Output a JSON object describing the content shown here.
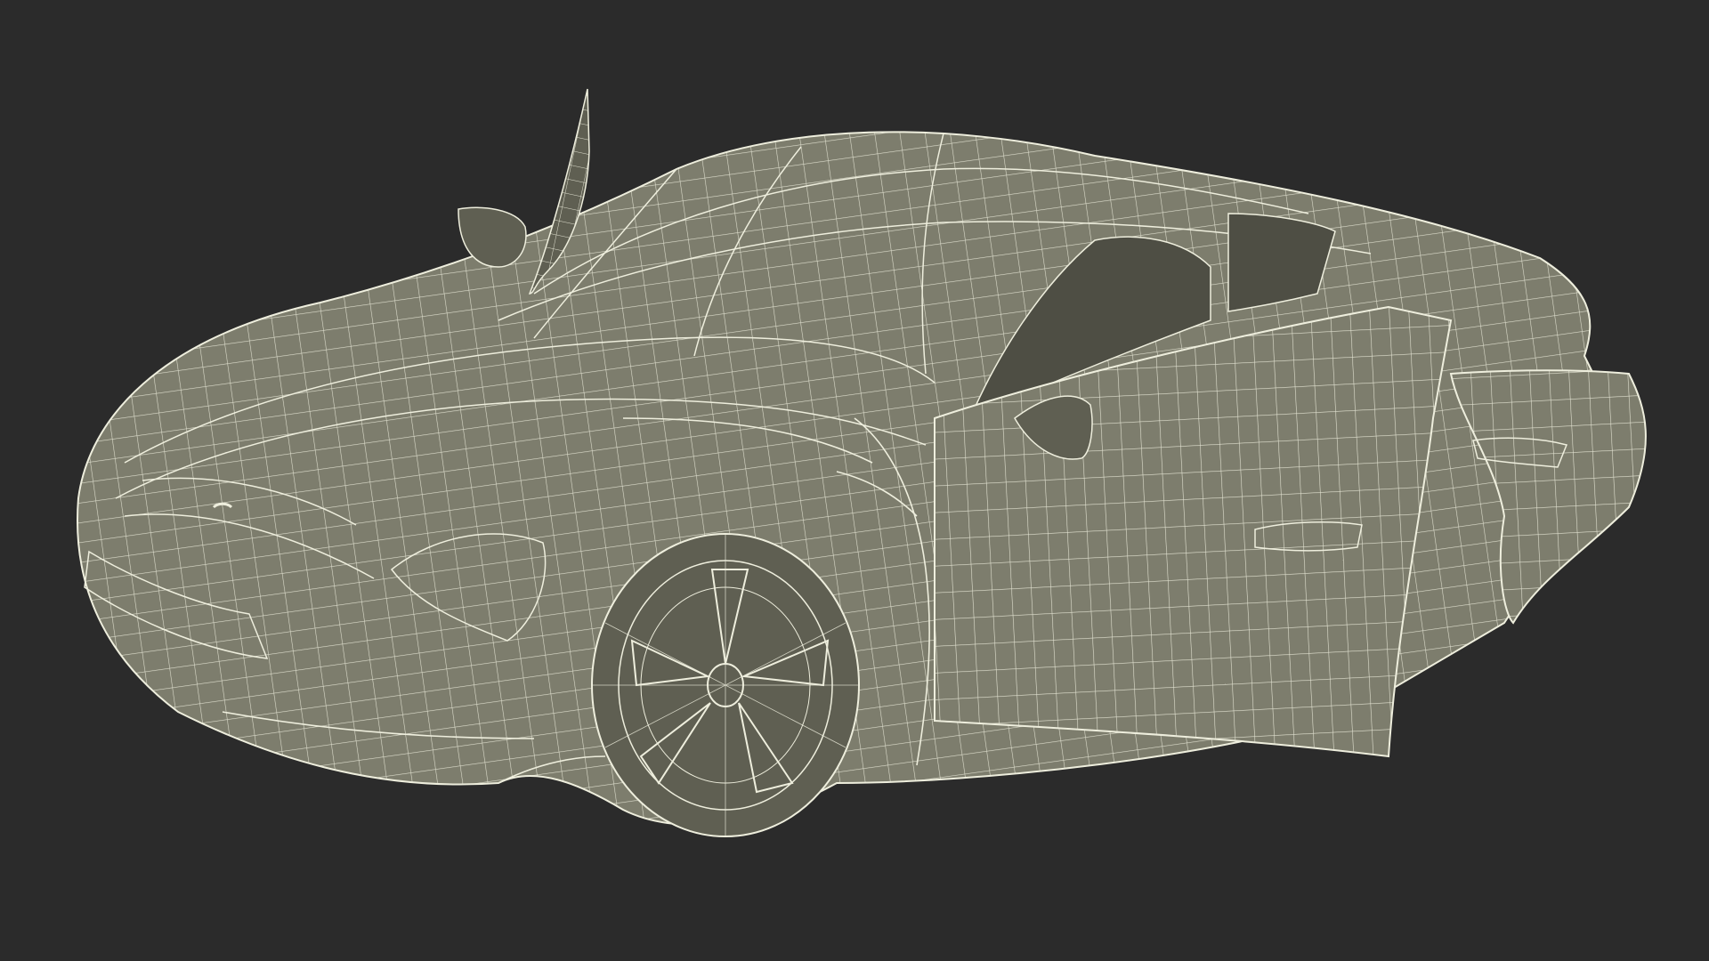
{
  "scene": {
    "background": "#2b2b2b",
    "mesh_fill": "#7d7d6d",
    "mesh_fill_dark": "#5f5f52",
    "wire_color": "#eeeedd",
    "shadow_color": "#4e4e44"
  }
}
